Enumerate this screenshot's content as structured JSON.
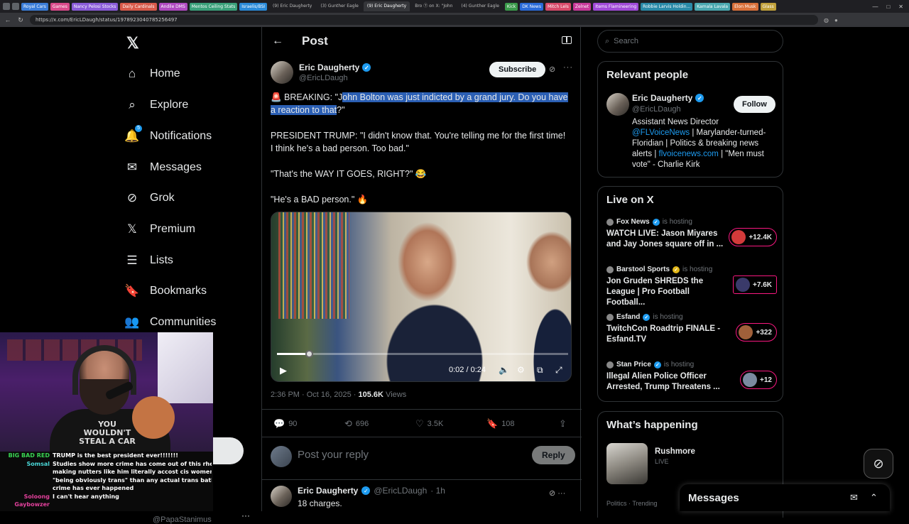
{
  "browser": {
    "bookmarks": [
      {
        "label": "Royal Cars",
        "color": "#3b7dd8"
      },
      {
        "label": "Games",
        "color": "#d84a8a"
      },
      {
        "label": "Nancy Pelosi Stocks",
        "color": "#8a5cd8"
      },
      {
        "label": "Daily Cardinals",
        "color": "#d85a4a"
      },
      {
        "label": "Andile DMS",
        "color": "#b04ac0"
      },
      {
        "label": "Mentos Ceiling Stats",
        "color": "#3aa07a"
      },
      {
        "label": "Israelis/BSI",
        "color": "#2a8ad8"
      }
    ],
    "tabs": [
      {
        "label": "(9) Eric Daugherty",
        "active": false
      },
      {
        "label": "(3) Gunther Eagle",
        "active": false
      },
      {
        "label": "(9) Eric Daugherty",
        "active": true
      },
      {
        "label": "Bro Ⓣ on X: \"John",
        "active": false
      },
      {
        "label": "(4) Gunther Eagle",
        "active": false
      }
    ],
    "bookmarks_right": [
      {
        "label": "Kick",
        "color": "#3a9a4a"
      },
      {
        "label": "DK News",
        "color": "#2a6ad8"
      },
      {
        "label": "Mitch Lels",
        "color": "#d84a6a"
      },
      {
        "label": "Zelnet",
        "color": "#c83a9a"
      },
      {
        "label": "Items Flamineering",
        "color": "#a04ad8"
      },
      {
        "label": "Robbie Larvis Holdin...",
        "color": "#2a8aa8"
      },
      {
        "label": "Kamala Lavala",
        "color": "#4aa8b0"
      },
      {
        "label": "Elon Musk",
        "color": "#d8703a"
      },
      {
        "label": "Glass",
        "color": "#c0a03a"
      }
    ],
    "url": "https://x.com/EricLDaugh/status/1978923040785256497"
  },
  "nav": {
    "items": [
      {
        "label": "Home",
        "icon": "home-icon",
        "glyph": "⌂"
      },
      {
        "label": "Explore",
        "icon": "search-icon",
        "glyph": "⌕"
      },
      {
        "label": "Notifications",
        "icon": "bell-icon",
        "glyph": "🔔",
        "badge": "5"
      },
      {
        "label": "Messages",
        "icon": "mail-icon",
        "glyph": "✉"
      },
      {
        "label": "Grok",
        "icon": "grok-icon",
        "glyph": "⊘"
      },
      {
        "label": "Premium",
        "icon": "x-premium-icon",
        "glyph": "𝕏"
      },
      {
        "label": "Lists",
        "icon": "list-icon",
        "glyph": "☰"
      },
      {
        "label": "Bookmarks",
        "icon": "bookmark-icon",
        "glyph": "🔖"
      },
      {
        "label": "Communities",
        "icon": "communities-icon",
        "glyph": "👥"
      }
    ]
  },
  "header": {
    "title": "Post"
  },
  "post": {
    "author_name": "Eric Daugherty",
    "author_handle": "@EricLDaugh",
    "subscribe_label": "Subscribe",
    "text_1_pre": "🚨 BREAKING: \"J",
    "text_1_hl": "ohn Bolton was just indicted by a grand jury. Do you have a reaction to that",
    "text_1_post": "?\"",
    "text_2": "PRESIDENT TRUMP: \"I didn't know that. You're telling me for the first time! I think he's a bad person. Too bad.\"",
    "text_3": "\"That's the WAY IT GOES, RIGHT?\" 😂",
    "text_4": "\"He's a BAD person.\" 🔥",
    "video": {
      "time": "0:02 / 0:24",
      "progress": 0.11
    },
    "timestamp": "2:36 PM · Oct 16, 2025 · ",
    "views_count": "105.6K",
    "views_label": " Views",
    "replies": "90",
    "reposts": "696",
    "likes": "3.5K",
    "bookmarks": "108"
  },
  "reply_box": {
    "placeholder": "Post your reply",
    "button": "Reply"
  },
  "reply": {
    "name": "Eric Daugherty",
    "handle": "@EricLDaugh",
    "time": "· 1h",
    "text": "18 charges."
  },
  "search": {
    "placeholder": "Search"
  },
  "relevant": {
    "title": "Relevant people",
    "name": "Eric Daugherty",
    "handle": "@EricLDaugh",
    "follow": "Follow",
    "bio_1": "Assistant News Director ",
    "bio_link_1": "@FLVoiceNews",
    "bio_2": " | Marylander-turned-Floridian | Politics & breaking news alerts | ",
    "bio_link_2": "flvoicenews.com",
    "bio_3": " | \"Men must vote\" - Charlie Kirk"
  },
  "live": {
    "title": "Live on X",
    "items": [
      {
        "host": "Fox News",
        "hosting": "is hosting",
        "title": "WATCH LIVE: Jason Miyares and Jay Jones square off in ...",
        "count": "+12.4K",
        "badge": "blue"
      },
      {
        "host": "Barstool Sports",
        "hosting": "is hosting",
        "title": "Jon Gruden SHREDS the League | Pro Football Football...",
        "count": "+7.6K",
        "badge": "gold"
      },
      {
        "host": "Esfand",
        "hosting": "is hosting",
        "title": "TwitchCon Roadtrip FINALE - Esfand.TV",
        "count": "+322",
        "badge": "blue"
      },
      {
        "host": "Stan Price",
        "hosting": "is hosting",
        "title": "Illegal Alien Police Officer Arrested, Trump Threatens ...",
        "count": "+12",
        "badge": "blue"
      }
    ]
  },
  "happening": {
    "title": "What’s happening",
    "item_title": "Rushmore",
    "item_sub": "LIVE",
    "meta": "Politics · Trending"
  },
  "dock": {
    "title": "Messages"
  },
  "stream": {
    "shirt": "YOU WOULDN'T STEAL A CAR",
    "behind_handle": "@PapaStanimus",
    "chat": [
      {
        "user": "BIG BAD RED",
        "user_color": "#39d353",
        "msg": "TRUMP is the best president ever!!!!!!!"
      },
      {
        "user": "Somsal",
        "user_color": "#4ad8d8",
        "msg": "Studies show more crime has come out of this rhetoric"
      },
      {
        "user": "",
        "user_color": "#fff",
        "msg": "making nutters like him literally accost cis women for"
      },
      {
        "user": "",
        "user_color": "#fff",
        "msg": "\"being obviously trans\" than any actual trans bathroom"
      },
      {
        "user": "",
        "user_color": "#fff",
        "msg": "crime has ever happened"
      },
      {
        "user": "Soloong Gaybowzer",
        "user_color": "#e0409a",
        "msg": "I can't hear anything"
      }
    ]
  }
}
